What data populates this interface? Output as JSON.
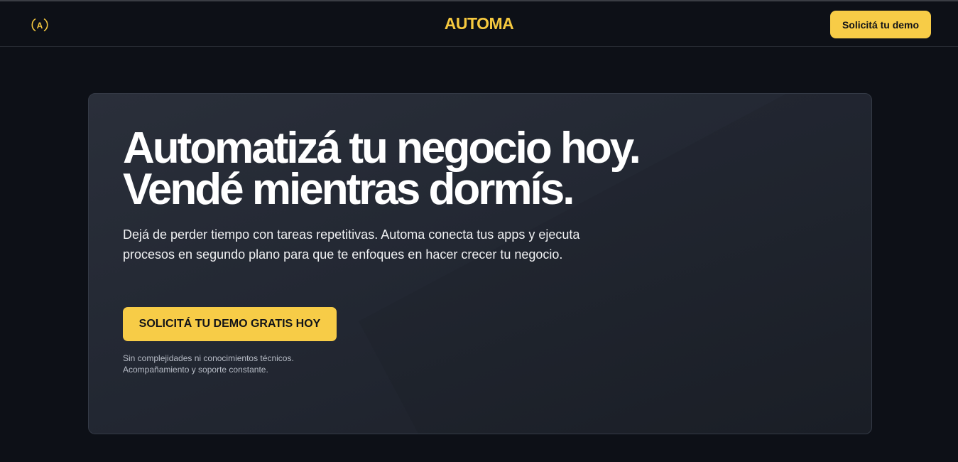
{
  "header": {
    "logo_letter": "A",
    "brand": "AUTOMA",
    "cta_label": "Solicitá tu demo"
  },
  "hero": {
    "headline_line1": "Automatizá tu negocio hoy.",
    "headline_line2": "Vendé mientras dormís.",
    "subtext": "Dejá de perder tiempo con tareas repetitivas. Automa conecta tus apps y ejecuta procesos en segundo plano para que te enfoques en hacer crecer tu negocio.",
    "cta_label": "SOLICITÁ TU DEMO GRATIS HOY",
    "note_line1": "Sin complejidades ni conocimientos técnicos.",
    "note_line2": "Acompañamiento y soporte constante."
  },
  "colors": {
    "accent": "#f7cc47",
    "background": "#0d1017",
    "card": "#262b35"
  }
}
